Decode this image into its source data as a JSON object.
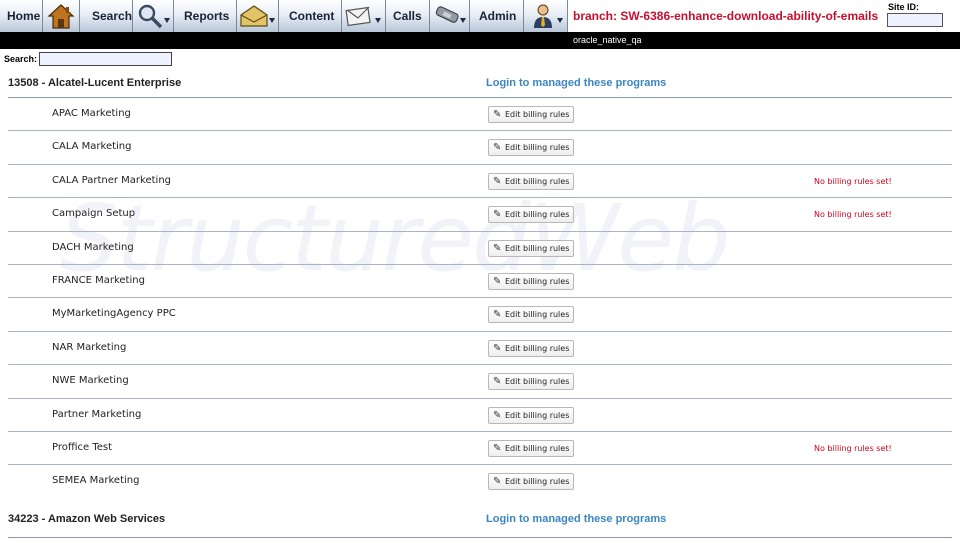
{
  "nav": {
    "home": "Home",
    "search": "Search",
    "reports": "Reports",
    "content": "Content",
    "calls": "Calls",
    "admin": "Admin",
    "icons": [
      "house-icon",
      "magnifier-icon",
      "envelope-open-icon",
      "letter-icon",
      "phone-icon",
      "user-icon"
    ]
  },
  "branch": "branch: SW-6386-enhance-download-ability-of-emails",
  "site_id": {
    "label": "Site ID:",
    "value": ""
  },
  "env": "oracle_native_qa",
  "search": {
    "label": "Search:",
    "value": ""
  },
  "watermark": "StructuredWeb",
  "companies": [
    {
      "name": "13508 - Alcatel-Lucent Enterprise",
      "login_label": "Login to managed these programs",
      "programs": [
        {
          "name": "APAC Marketing",
          "button": "Edit billing rules",
          "warning": ""
        },
        {
          "name": "CALA Marketing",
          "button": "Edit billing rules",
          "warning": ""
        },
        {
          "name": "CALA Partner Marketing",
          "button": "Edit billing rules",
          "warning": "No billing rules set!"
        },
        {
          "name": "Campaign Setup",
          "button": "Edit billing rules",
          "warning": "No billing rules set!"
        },
        {
          "name": "DACH Marketing",
          "button": "Edit billing rules",
          "warning": ""
        },
        {
          "name": "FRANCE Marketing",
          "button": "Edit billing rules",
          "warning": ""
        },
        {
          "name": "MyMarketingAgency PPC",
          "button": "Edit billing rules",
          "warning": ""
        },
        {
          "name": "NAR Marketing",
          "button": "Edit billing rules",
          "warning": ""
        },
        {
          "name": "NWE Marketing",
          "button": "Edit billing rules",
          "warning": ""
        },
        {
          "name": "Partner Marketing",
          "button": "Edit billing rules",
          "warning": ""
        },
        {
          "name": "Proffice Test",
          "button": "Edit billing rules",
          "warning": "No billing rules set!"
        },
        {
          "name": "SEMEA Marketing",
          "button": "Edit billing rules",
          "warning": ""
        }
      ]
    },
    {
      "name": "34223 - Amazon Web Services",
      "login_label": "Login to managed these programs",
      "programs": []
    }
  ],
  "colors": {
    "link": "#3b86c2",
    "warning": "#d0021b",
    "branch": "#c8102e",
    "rule": "#a7b4c7"
  }
}
